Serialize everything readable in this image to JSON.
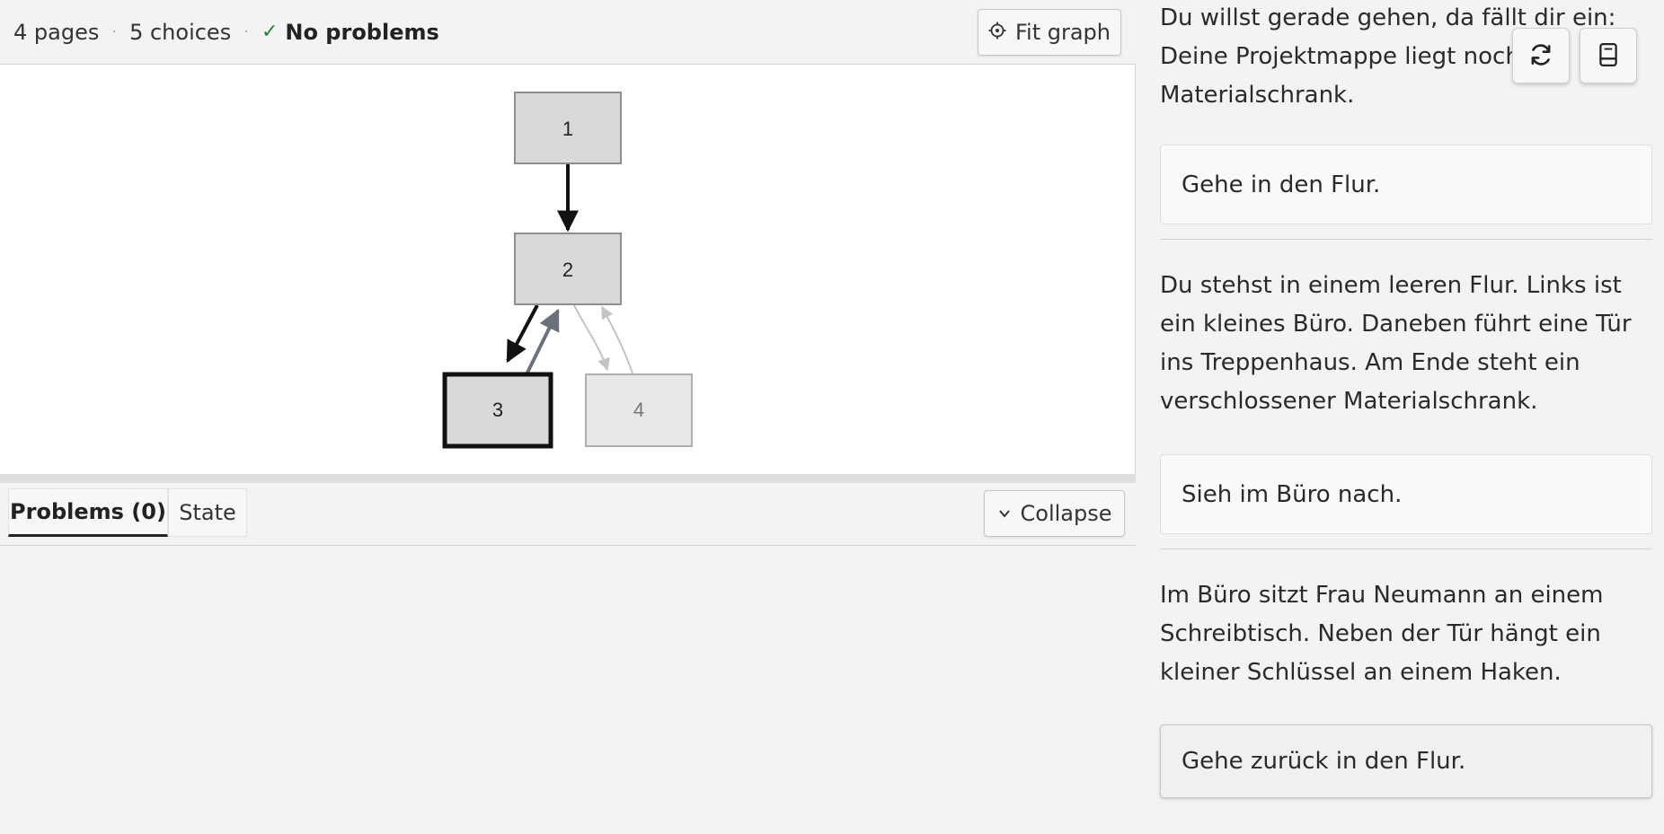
{
  "status": {
    "pages": "4 pages",
    "separator": "·",
    "choices": "5 choices",
    "problems_ok": "No problems"
  },
  "toolbar": {
    "fit_graph_label": "Fit graph",
    "collapse_label": "Collapse"
  },
  "graph": {
    "nodes": [
      {
        "label": "1",
        "state": "visited"
      },
      {
        "label": "2",
        "state": "visited"
      },
      {
        "label": "3",
        "state": "current"
      },
      {
        "label": "4",
        "state": "unvisited"
      }
    ],
    "edges": [
      {
        "from": "1",
        "to": "2",
        "state": "taken"
      },
      {
        "from": "2",
        "to": "3",
        "state": "taken"
      },
      {
        "from": "3",
        "to": "2",
        "state": "recent"
      },
      {
        "from": "2",
        "to": "4",
        "state": "untaken"
      },
      {
        "from": "4",
        "to": "2",
        "state": "untaken"
      }
    ]
  },
  "tabs": [
    {
      "label": "Problems (0)",
      "active": true
    },
    {
      "label": "State",
      "active": false
    }
  ],
  "story": {
    "passages": [
      {
        "text": "Du willst gerade gehen, da fällt dir ein: Deine Projektmappe liegt noch im Materialschrank."
      },
      {
        "choice": "Gehe in den Flur."
      },
      {
        "text": "Du stehst in einem leeren Flur. Links ist ein kleines Büro. Daneben führt eine Tür ins Treppenhaus. Am Ende steht ein verschlossener Materialschrank."
      },
      {
        "choice": "Sieh im Büro nach."
      },
      {
        "text": "Im Büro sitzt Frau Neumann an einem Schreibtisch. Neben der Tür hängt ein kleiner Schlüssel an einem Haken."
      },
      {
        "choice": "Gehe zurück in den Flur."
      }
    ]
  },
  "icons": {
    "restart": "refresh-icon",
    "book": "book-icon",
    "fit": "crosshair-icon",
    "collapse": "chevron-down-icon",
    "ok": "check-icon"
  },
  "colors": {
    "ok_green": "#2e7d32",
    "node_fill": "#d9d9d9",
    "node_unvisited_fill": "#e8e8e8",
    "edge_taken": "#111111",
    "edge_recent": "#6b717a",
    "edge_untaken": "#c4c4c4"
  }
}
